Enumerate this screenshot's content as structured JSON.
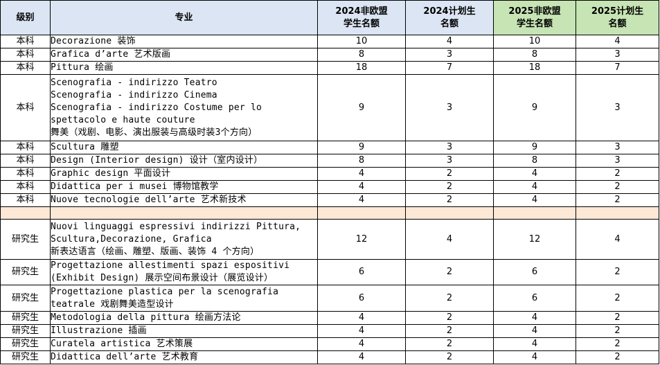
{
  "header": {
    "level": "级别",
    "major": "专业",
    "q2024_non_eu": "2024非欧盟\n学生名额",
    "q2024_plan": "2024计划生\n名额",
    "q2025_non_eu": "2025非欧盟\n学生名额",
    "q2025_plan": "2025计划生\n名额"
  },
  "undergrad": [
    {
      "level": "本科",
      "major": "Decorazione 装饰",
      "a": "10",
      "b": "4",
      "c": "10",
      "d": "4"
    },
    {
      "level": "本科",
      "major": "Grafica d’arte 艺术版画",
      "a": "8",
      "b": "3",
      "c": "8",
      "d": "3"
    },
    {
      "level": "本科",
      "major": "Pittura 绘画",
      "a": "18",
      "b": "7",
      "c": "18",
      "d": "7"
    },
    {
      "level": "本科",
      "major": "Scenografia - indirizzo Teatro\nScenografia - indirizzo Cinema\nScenografia - indirizzo Costume per lo\nspettacolo e haute couture\n舞美（戏剧、电影、演出服装与高级时装3个方向）",
      "a": "9",
      "b": "3",
      "c": "9",
      "d": "3"
    },
    {
      "level": "本科",
      "major": "Scultura 雕塑",
      "a": "9",
      "b": "3",
      "c": "9",
      "d": "3"
    },
    {
      "level": "本科",
      "major": "Design (Interior design) 设计（室内设计）",
      "a": "8",
      "b": "3",
      "c": "8",
      "d": "3"
    },
    {
      "level": "本科",
      "major": "Graphic design 平面设计",
      "a": "4",
      "b": "2",
      "c": "4",
      "d": "2"
    },
    {
      "level": "本科",
      "major": "Didattica per i musei 博物馆教学",
      "a": "4",
      "b": "2",
      "c": "4",
      "d": "2"
    },
    {
      "level": "本科",
      "major": "Nuove tecnologie dell’arte 艺术新技术",
      "a": "4",
      "b": "2",
      "c": "4",
      "d": "2"
    }
  ],
  "graduate": [
    {
      "level": "研究生",
      "major": "Nuovi linguaggi espressivi indirizzi Pittura,\nScultura,Decorazione, Grafica\n新表达语言（绘画、雕塑、版画、装饰 4 个方向）",
      "a": "12",
      "b": "4",
      "c": "12",
      "d": "4"
    },
    {
      "level": "研究生",
      "major": "Progettazione allestimenti spazi espositivi\n(Exhibit Design) 展示空间布景设计（展览设计）",
      "a": "6",
      "b": "2",
      "c": "6",
      "d": "2"
    },
    {
      "level": "研究生",
      "major": "Progettazione plastica per la scenografia\nteatrale 戏剧舞美造型设计",
      "a": "6",
      "b": "2",
      "c": "6",
      "d": "2"
    },
    {
      "level": "研究生",
      "major": "Metodologia della pittura 绘画方法论",
      "a": "4",
      "b": "2",
      "c": "4",
      "d": "2"
    },
    {
      "level": "研究生",
      "major": "Illustrazione 插画",
      "a": "4",
      "b": "2",
      "c": "4",
      "d": "2"
    },
    {
      "level": "研究生",
      "major": "Curatela artistica 艺术策展",
      "a": "4",
      "b": "2",
      "c": "4",
      "d": "2"
    },
    {
      "level": "研究生",
      "major": "Didattica dell’arte 艺术教育",
      "a": "4",
      "b": "2",
      "c": "4",
      "d": "2"
    }
  ]
}
